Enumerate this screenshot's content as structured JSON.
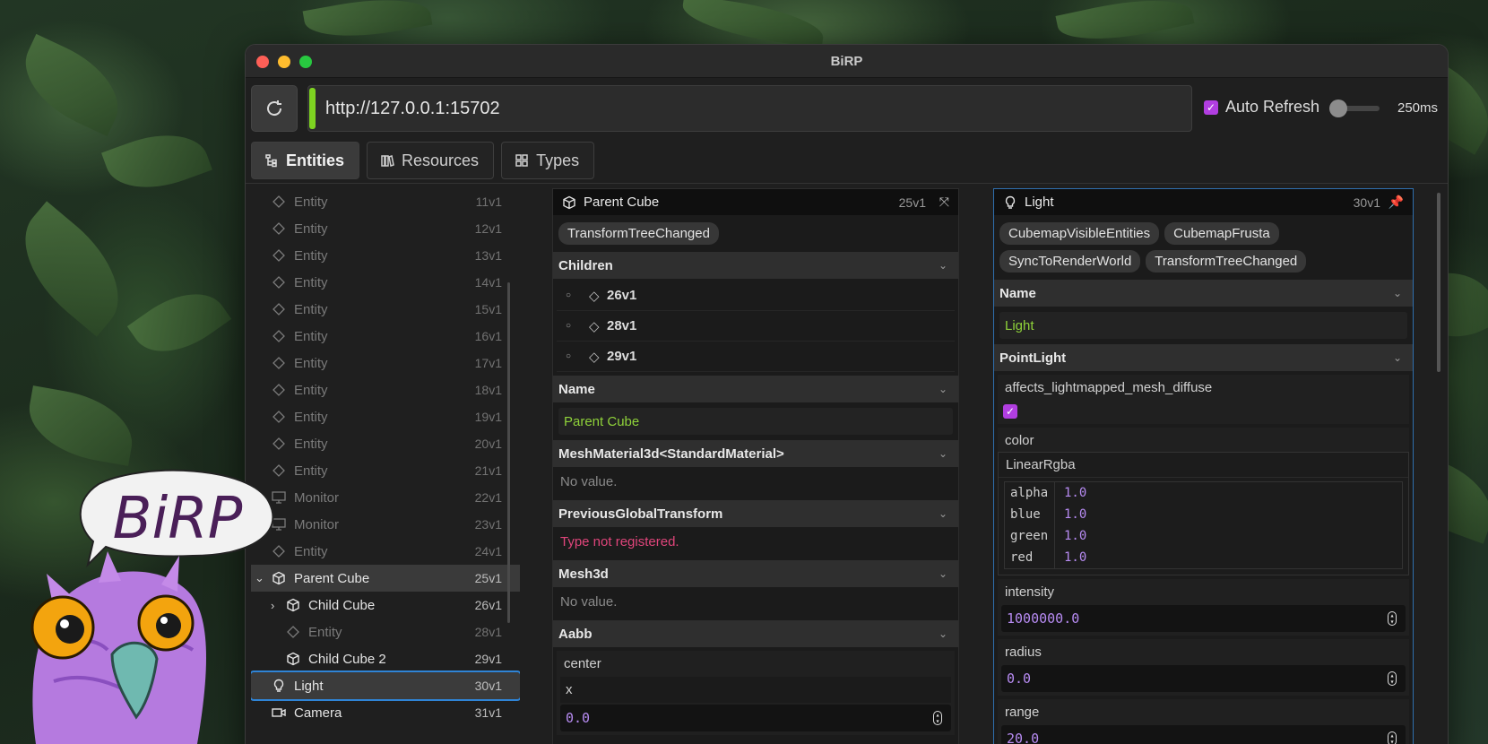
{
  "window": {
    "title": "BiRP"
  },
  "toolbar": {
    "url": "http://127.0.0.1:15702",
    "auto_refresh_label": "Auto Refresh",
    "auto_refresh_checked": true,
    "interval": "250ms"
  },
  "tabs": [
    {
      "label": "Entities",
      "icon": "tree-icon",
      "active": true
    },
    {
      "label": "Resources",
      "icon": "books-icon",
      "active": false
    },
    {
      "label": "Types",
      "icon": "grid-icon",
      "active": false
    }
  ],
  "entities": [
    {
      "label": "Entity",
      "id": "11v1",
      "icon": "diamond-icon",
      "state": "dim"
    },
    {
      "label": "Entity",
      "id": "12v1",
      "icon": "diamond-icon",
      "state": "dim"
    },
    {
      "label": "Entity",
      "id": "13v1",
      "icon": "diamond-icon",
      "state": "dim"
    },
    {
      "label": "Entity",
      "id": "14v1",
      "icon": "diamond-icon",
      "state": "dim"
    },
    {
      "label": "Entity",
      "id": "15v1",
      "icon": "diamond-icon",
      "state": "dim"
    },
    {
      "label": "Entity",
      "id": "16v1",
      "icon": "diamond-icon",
      "state": "dim"
    },
    {
      "label": "Entity",
      "id": "17v1",
      "icon": "diamond-icon",
      "state": "dim"
    },
    {
      "label": "Entity",
      "id": "18v1",
      "icon": "diamond-icon",
      "state": "dim"
    },
    {
      "label": "Entity",
      "id": "19v1",
      "icon": "diamond-icon",
      "state": "dim"
    },
    {
      "label": "Entity",
      "id": "20v1",
      "icon": "diamond-icon",
      "state": "dim"
    },
    {
      "label": "Entity",
      "id": "21v1",
      "icon": "diamond-icon",
      "state": "dim"
    },
    {
      "label": "Monitor",
      "id": "22v1",
      "icon": "monitor-icon",
      "state": "dim"
    },
    {
      "label": "Monitor",
      "id": "23v1",
      "icon": "monitor-icon",
      "state": "dim"
    },
    {
      "label": "Entity",
      "id": "24v1",
      "icon": "diamond-icon",
      "state": "dim"
    },
    {
      "label": "Parent Cube",
      "id": "25v1",
      "icon": "cube-icon",
      "state": "selected",
      "expander": "down",
      "indent": 0
    },
    {
      "label": "Child Cube",
      "id": "26v1",
      "icon": "cube-icon",
      "state": "bright",
      "expander": "right",
      "indent": 1
    },
    {
      "label": "Entity",
      "id": "28v1",
      "icon": "diamond-icon",
      "state": "dim",
      "indent": 1
    },
    {
      "label": "Child Cube 2",
      "id": "29v1",
      "icon": "cube-icon",
      "state": "bright",
      "indent": 1
    },
    {
      "label": "Light",
      "id": "30v1",
      "icon": "bulb-icon",
      "state": "focused",
      "indent": 0
    },
    {
      "label": "Camera",
      "id": "31v1",
      "icon": "camera-icon",
      "state": "bright",
      "indent": 0
    }
  ],
  "parent_panel": {
    "title": "Parent Cube",
    "id": "25v1",
    "chips": [
      "TransformTreeChanged"
    ],
    "children_title": "Children",
    "children": [
      "26v1",
      "28v1",
      "29v1"
    ],
    "name_title": "Name",
    "name_value": "Parent Cube",
    "mesh_material_title": "MeshMaterial3d<StandardMaterial>",
    "mesh_material_value": "No value.",
    "prev_transform_title": "PreviousGlobalTransform",
    "prev_transform_value": "Type not registered.",
    "mesh3d_title": "Mesh3d",
    "mesh3d_value": "No value.",
    "aabb_title": "Aabb",
    "center_label": "center",
    "x_label": "x",
    "x_value": "0.0"
  },
  "light_panel": {
    "title": "Light",
    "id": "30v1",
    "chips": [
      "CubemapVisibleEntities",
      "CubemapFrusta",
      "SyncToRenderWorld",
      "TransformTreeChanged"
    ],
    "name_title": "Name",
    "name_value": "Light",
    "point_light_title": "PointLight",
    "affects_label": "affects_lightmapped_mesh_diffuse",
    "affects_checked": true,
    "color_label": "color",
    "color_type": "LinearRgba",
    "color_fields": [
      {
        "key": "alpha",
        "value": "1.0"
      },
      {
        "key": "blue",
        "value": "1.0"
      },
      {
        "key": "green",
        "value": "1.0"
      },
      {
        "key": "red",
        "value": "1.0"
      }
    ],
    "intensity_label": "intensity",
    "intensity_value": "1000000.0",
    "radius_label": "radius",
    "radius_value": "0.0",
    "range_label": "range",
    "range_value": "20.0"
  },
  "mascot": {
    "speech_text": "BiRP"
  },
  "colors": {
    "accent_green": "#7ed321",
    "accent_purple": "#b13ee0",
    "focus_blue": "#2f84d6",
    "error_pink": "#e0457b",
    "name_green": "#8fd23a",
    "number_purple": "#b78bf2"
  }
}
